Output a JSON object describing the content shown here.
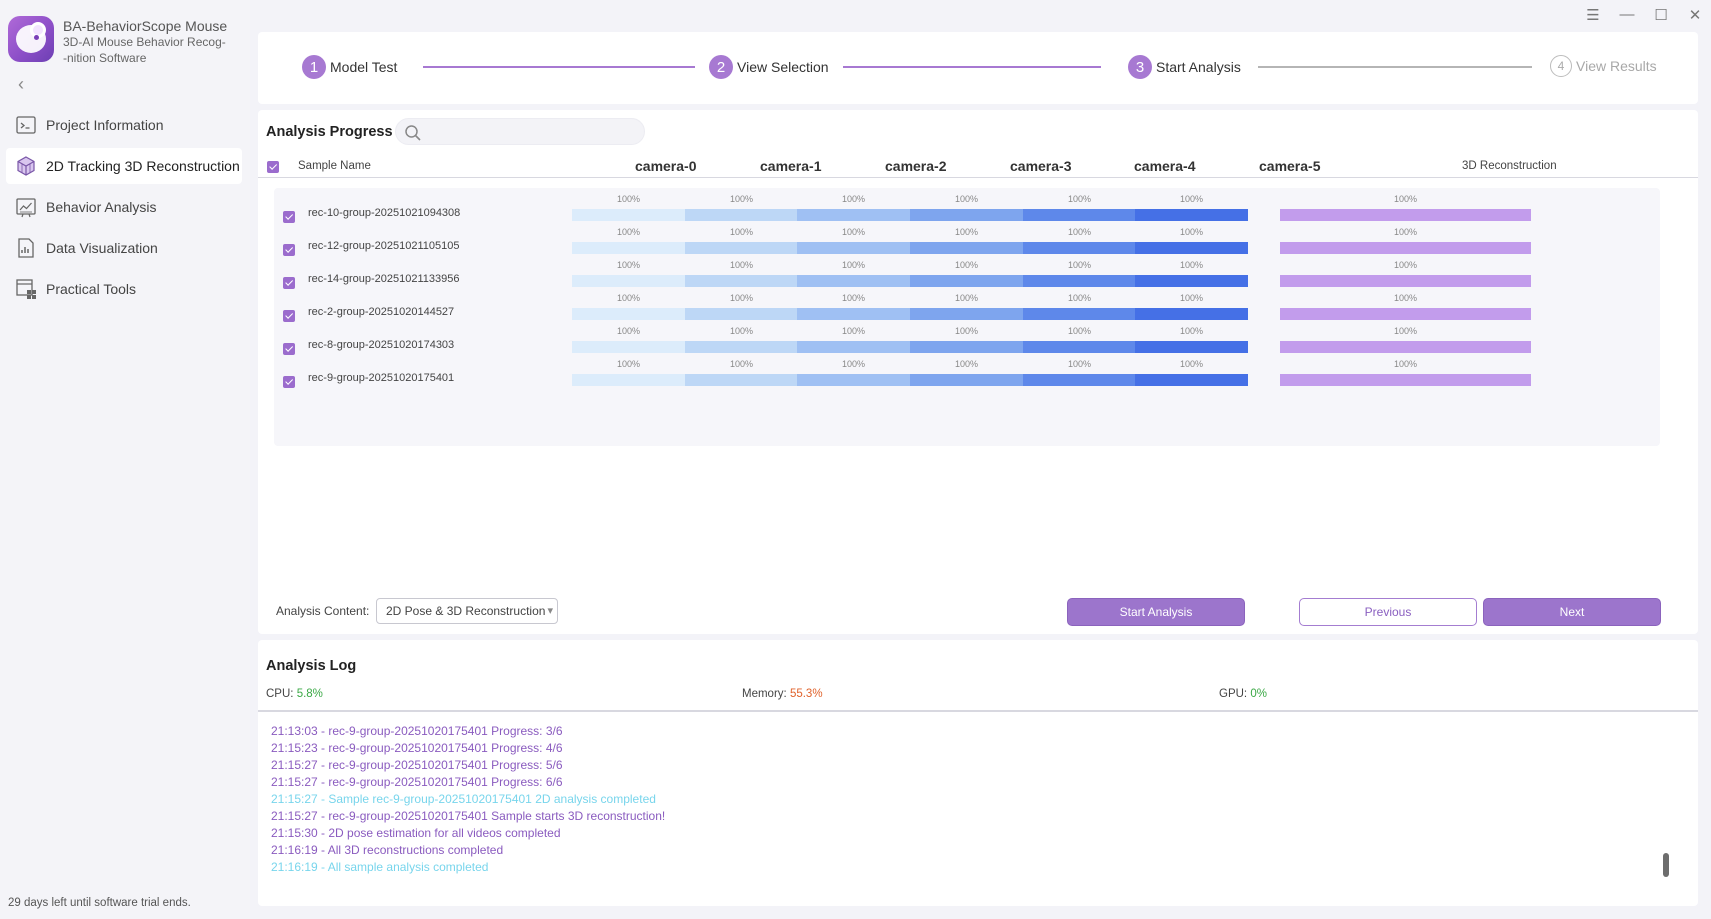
{
  "app": {
    "title": "BA-BehaviorScope Mouse",
    "subtitle_line1": "3D-AI Mouse Behavior Recog-",
    "subtitle_line2": "-nition Software",
    "back": "‹"
  },
  "sidebar": {
    "items": [
      {
        "label": "Project Information",
        "icon": "terminal-icon",
        "active": false
      },
      {
        "label": "2D Tracking 3D Reconstruction",
        "icon": "cube-icon",
        "active": true
      },
      {
        "label": "Behavior Analysis",
        "icon": "chart-board-icon",
        "active": false
      },
      {
        "label": "Data Visualization",
        "icon": "document-chart-icon",
        "active": false
      },
      {
        "label": "Practical Tools",
        "icon": "toolbox-icon",
        "active": false
      }
    ],
    "trial_notice": "29 days left until software trial ends."
  },
  "window_controls": {
    "menu": "☰",
    "minimize": "—",
    "maximize": "☐",
    "close": "✕"
  },
  "stepper": {
    "steps": [
      {
        "num": "1",
        "label": "Model Test",
        "state": "done"
      },
      {
        "num": "2",
        "label": "View Selection",
        "state": "done"
      },
      {
        "num": "3",
        "label": "Start Analysis",
        "state": "current"
      },
      {
        "num": "4",
        "label": "View Results",
        "state": "pending"
      }
    ]
  },
  "progress": {
    "title": "Analysis Progress",
    "search_placeholder": "",
    "headers": {
      "sample_name": "Sample Name",
      "cameras": [
        "camera-0",
        "camera-1",
        "camera-2",
        "camera-3",
        "camera-4",
        "camera-5"
      ],
      "recon": "3D Reconstruction"
    },
    "camera_colors": [
      "#dcecfb",
      "#bdd7f6",
      "#9fc0f3",
      "#7ea5ee",
      "#5e88ea",
      "#4570e6"
    ],
    "recon_color": "#c29cec",
    "rows": [
      {
        "name": "rec-10-group-20251021094308",
        "checked": true,
        "cameras": [
          "100%",
          "100%",
          "100%",
          "100%",
          "100%",
          "100%"
        ],
        "recon": "100%"
      },
      {
        "name": "rec-12-group-20251021105105",
        "checked": true,
        "cameras": [
          "100%",
          "100%",
          "100%",
          "100%",
          "100%",
          "100%"
        ],
        "recon": "100%"
      },
      {
        "name": "rec-14-group-20251021133956",
        "checked": true,
        "cameras": [
          "100%",
          "100%",
          "100%",
          "100%",
          "100%",
          "100%"
        ],
        "recon": "100%"
      },
      {
        "name": "rec-2-group-20251020144527",
        "checked": true,
        "cameras": [
          "100%",
          "100%",
          "100%",
          "100%",
          "100%",
          "100%"
        ],
        "recon": "100%"
      },
      {
        "name": "rec-8-group-20251020174303",
        "checked": true,
        "cameras": [
          "100%",
          "100%",
          "100%",
          "100%",
          "100%",
          "100%"
        ],
        "recon": "100%"
      },
      {
        "name": "rec-9-group-20251020175401",
        "checked": true,
        "cameras": [
          "100%",
          "100%",
          "100%",
          "100%",
          "100%",
          "100%"
        ],
        "recon": "100%"
      }
    ],
    "content_label": "Analysis Content:",
    "content_value": "2D Pose & 3D Reconstruction",
    "start_button": "Start Analysis",
    "previous_button": "Previous",
    "next_button": "Next"
  },
  "log": {
    "title": "Analysis Log",
    "cpu_label": "CPU:",
    "cpu_value": "5.8%",
    "memory_label": "Memory:",
    "memory_value": "55.3%",
    "gpu_label": "GPU:",
    "gpu_value": "0%",
    "lines": [
      {
        "text": "21:13:03 - rec-9-group-20251020175401 Progress: 3/6",
        "color": "purple"
      },
      {
        "text": "21:15:23 - rec-9-group-20251020175401 Progress: 4/6",
        "color": "purple"
      },
      {
        "text": "21:15:27 - rec-9-group-20251020175401 Progress: 5/6",
        "color": "purple"
      },
      {
        "text": "21:15:27 - rec-9-group-20251020175401 Progress: 6/6",
        "color": "purple"
      },
      {
        "text": "21:15:27 - Sample rec-9-group-20251020175401 2D analysis completed",
        "color": "cyan"
      },
      {
        "text": "21:15:27 - rec-9-group-20251020175401 Sample starts 3D reconstruction!",
        "color": "purple"
      },
      {
        "text": "21:15:30 - 2D pose estimation for all videos completed",
        "color": "purple"
      },
      {
        "text": "21:16:19 - All 3D reconstructions completed",
        "color": "purple"
      },
      {
        "text": "21:16:19 - All sample analysis completed",
        "color": "cyan"
      }
    ]
  }
}
